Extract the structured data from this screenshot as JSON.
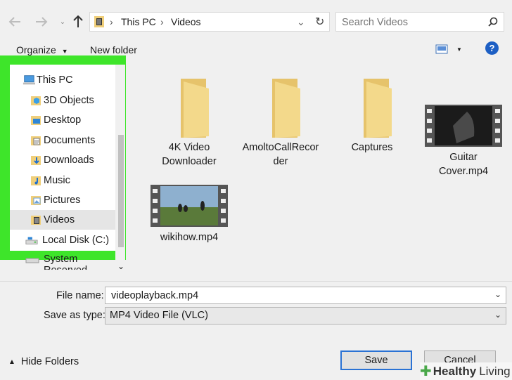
{
  "breadcrumb": {
    "root": "This PC",
    "current": "Videos"
  },
  "search": {
    "placeholder": "Search Videos"
  },
  "toolbar": {
    "organize": "Organize",
    "new_folder": "New folder",
    "help": "?"
  },
  "nav": {
    "items": [
      {
        "label": "This PC",
        "icon": "computer-icon"
      },
      {
        "label": "3D Objects",
        "icon": "3d-objects-icon"
      },
      {
        "label": "Desktop",
        "icon": "desktop-icon"
      },
      {
        "label": "Documents",
        "icon": "documents-icon"
      },
      {
        "label": "Downloads",
        "icon": "downloads-icon"
      },
      {
        "label": "Music",
        "icon": "music-icon"
      },
      {
        "label": "Pictures",
        "icon": "pictures-icon"
      },
      {
        "label": "Videos",
        "icon": "videos-icon",
        "selected": true
      },
      {
        "label": "Local Disk (C:)",
        "icon": "drive-icon"
      },
      {
        "label": "System Reserved",
        "icon": "drive-icon"
      }
    ]
  },
  "files": [
    {
      "line1": "4K Video",
      "line2": "Downloader",
      "type": "folder"
    },
    {
      "line1": "AmoltoCallRecor",
      "line2": "der",
      "type": "folder"
    },
    {
      "line1": "Captures",
      "line2": "",
      "type": "folder"
    },
    {
      "line1": "Guitar",
      "line2": "Cover.mp4",
      "type": "video"
    },
    {
      "line1": "wikihow.mp4",
      "line2": "",
      "type": "video"
    }
  ],
  "form": {
    "filename_label": "File name:",
    "filename_value": "videoplayback.mp4",
    "type_label": "Save as type:",
    "type_value": "MP4 Video File (VLC)"
  },
  "footer": {
    "hide_folders": "Hide Folders",
    "save": "Save",
    "cancel": "Cancel"
  },
  "watermark": {
    "brand1": "Healthy",
    "brand2": "Living"
  },
  "colors": {
    "highlight": "#3ee52a",
    "folder": "#f0cf7a",
    "accent": "#2a72d4"
  }
}
